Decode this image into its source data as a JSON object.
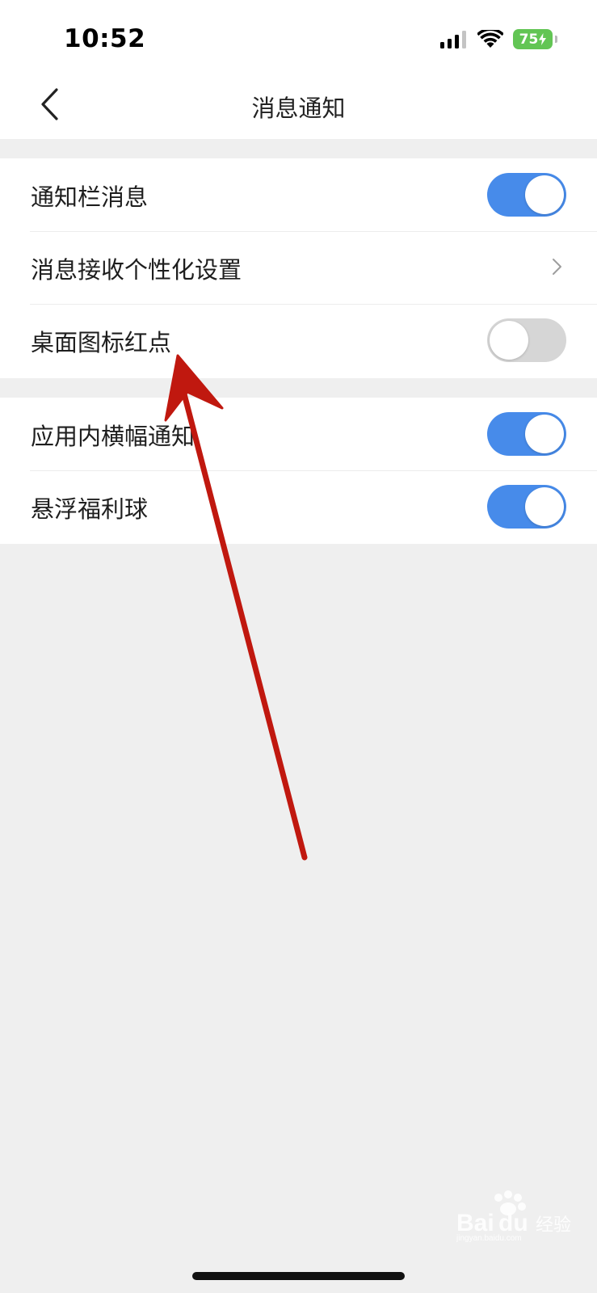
{
  "status_bar": {
    "time": "10:52",
    "battery_level": "75",
    "icons": [
      "signal-icon",
      "wifi-icon",
      "battery-charging-icon"
    ]
  },
  "nav": {
    "title": "消息通知",
    "back_icon": "chevron-left-icon"
  },
  "sections": [
    {
      "rows": [
        {
          "label": "通知栏消息",
          "control": "toggle",
          "enabled": true
        },
        {
          "label": "消息接收个性化设置",
          "control": "chevron"
        },
        {
          "label": "桌面图标红点",
          "control": "toggle",
          "enabled": false
        }
      ]
    },
    {
      "rows": [
        {
          "label": "应用内横幅通知",
          "control": "toggle",
          "enabled": true
        },
        {
          "label": "悬浮福利球",
          "control": "toggle",
          "enabled": true
        }
      ]
    }
  ],
  "colors": {
    "toggle_on": "#478bea",
    "toggle_off": "#d6d6d6",
    "page_background": "#efefef",
    "annotation_arrow": "#c0180f"
  },
  "watermark": {
    "brand": "Baidu经验",
    "url": "jingyan.baidu.com"
  }
}
